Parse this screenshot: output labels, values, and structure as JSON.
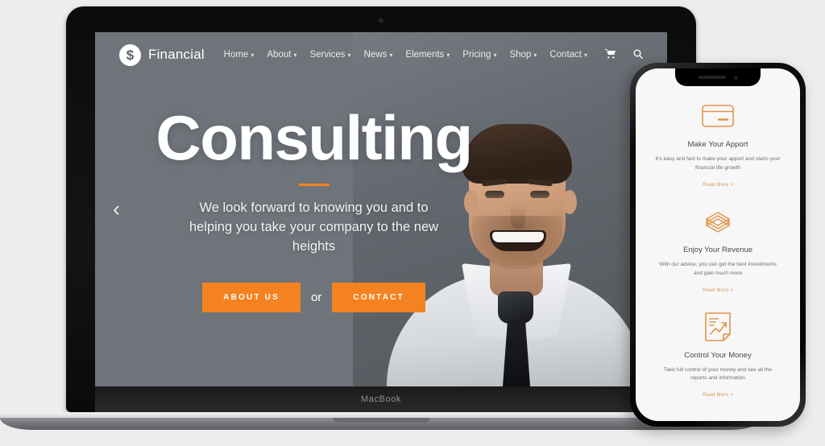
{
  "devices": {
    "laptop_label": "MacBook",
    "laptop_name": "macbook-mockup",
    "phone_name": "iphone-mockup"
  },
  "site": {
    "brand": {
      "mark": "$",
      "name": "Financial"
    },
    "nav": [
      {
        "label": "Home",
        "has_dropdown": true
      },
      {
        "label": "About",
        "has_dropdown": true
      },
      {
        "label": "Services",
        "has_dropdown": true
      },
      {
        "label": "News",
        "has_dropdown": true
      },
      {
        "label": "Elements",
        "has_dropdown": true
      },
      {
        "label": "Pricing",
        "has_dropdown": true
      },
      {
        "label": "Shop",
        "has_dropdown": true
      },
      {
        "label": "Contact",
        "has_dropdown": true
      }
    ],
    "nav_icons": [
      {
        "name": "cart-icon",
        "glyph": "Ὥ2"
      },
      {
        "name": "search-icon",
        "glyph": "⚲"
      }
    ],
    "hero": {
      "title": "Consulting",
      "subtitle": "We look forward to knowing you and to helping you take your company to the new heights",
      "primary_button": "ABOUT US",
      "connector": "or",
      "secondary_button": "CONTACT",
      "prev_arrow": "‹"
    }
  },
  "phone": {
    "cards": [
      {
        "icon": "credit-card-icon",
        "title": "Make Your Apport",
        "text": "It's easy and fast to make your apport and starts your financial life growth",
        "link": "Read More >"
      },
      {
        "icon": "money-stack-icon",
        "title": "Enjoy Your Revenue",
        "text": "With our advice, you can get the best investments and gain much more",
        "link": "Read More >"
      },
      {
        "icon": "report-chart-icon",
        "title": "Control Your Money",
        "text": "Take full control of your money and see all the reports and information",
        "link": "Read More >"
      }
    ]
  },
  "colors": {
    "accent": "#f58220",
    "hero_bg": "#6e747a",
    "page_bg": "#ededed",
    "link": "#d79a5b"
  }
}
